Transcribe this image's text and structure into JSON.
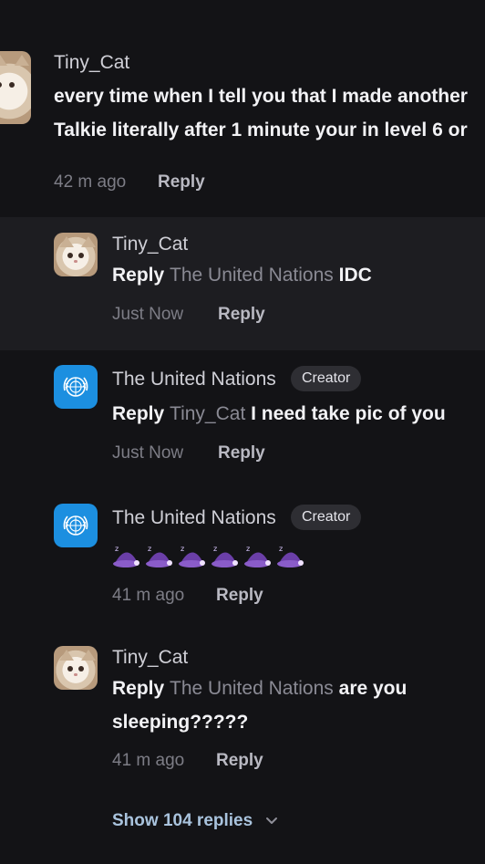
{
  "comments": [
    {
      "user": "Tiny_Cat",
      "text_line1": "every time when I tell you that I made another",
      "text_line2": "Talkie literally after 1 minute your in level 6 or",
      "time": "42 m ago",
      "reply_label": "Reply"
    },
    {
      "user": "Tiny_Cat",
      "reply_prefix": "Reply",
      "mention": "The United Nations",
      "text": "IDC",
      "time": "Just Now",
      "reply_label": "Reply"
    },
    {
      "user": "The United Nations",
      "badge": "Creator",
      "reply_prefix": "Reply",
      "mention": "Tiny_Cat",
      "text": "I need take pic of you",
      "time": "Just Now",
      "reply_label": "Reply"
    },
    {
      "user": "The United Nations",
      "badge": "Creator",
      "emoji": "sleeping-hat-emoji",
      "emoji_count": 6,
      "time": "41 m ago",
      "reply_label": "Reply"
    },
    {
      "user": "Tiny_Cat",
      "reply_prefix": "Reply",
      "mention": "The United Nations",
      "text_line1": "are you",
      "text_line2": "sleeping?????",
      "time": "41 m ago",
      "reply_label": "Reply"
    }
  ],
  "show_replies": "Show 104 replies",
  "icons": {
    "expand": "chevron-down-icon"
  },
  "colors": {
    "background": "#131316",
    "highlight": "#1d1d21",
    "link": "#a9c3dd",
    "un_blue": "#1c8fe0"
  }
}
